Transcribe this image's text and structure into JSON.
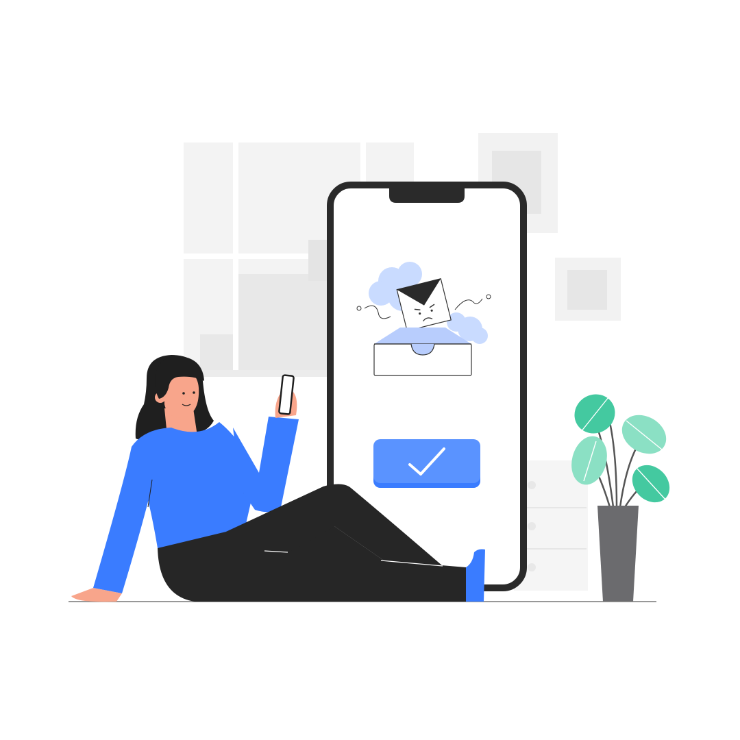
{
  "scene": {
    "description_free": true,
    "colors": {
      "accent_blue": "#3a7cff",
      "button_blue": "#5a93ff",
      "dark": "#262626",
      "leaf_green": "#44c9a0",
      "leaf_light": "#8be0c4",
      "pot": "#6b6b6e",
      "skin": "#f8a58b",
      "light_gray": "#f2f2f2",
      "mid_gray": "#e6e6e6",
      "cloud_blue": "#c9dbff"
    },
    "icons": {
      "confirm": "checkmark-icon",
      "inbox": "inbox-tray-icon",
      "envelope": "angry-envelope-icon"
    }
  }
}
